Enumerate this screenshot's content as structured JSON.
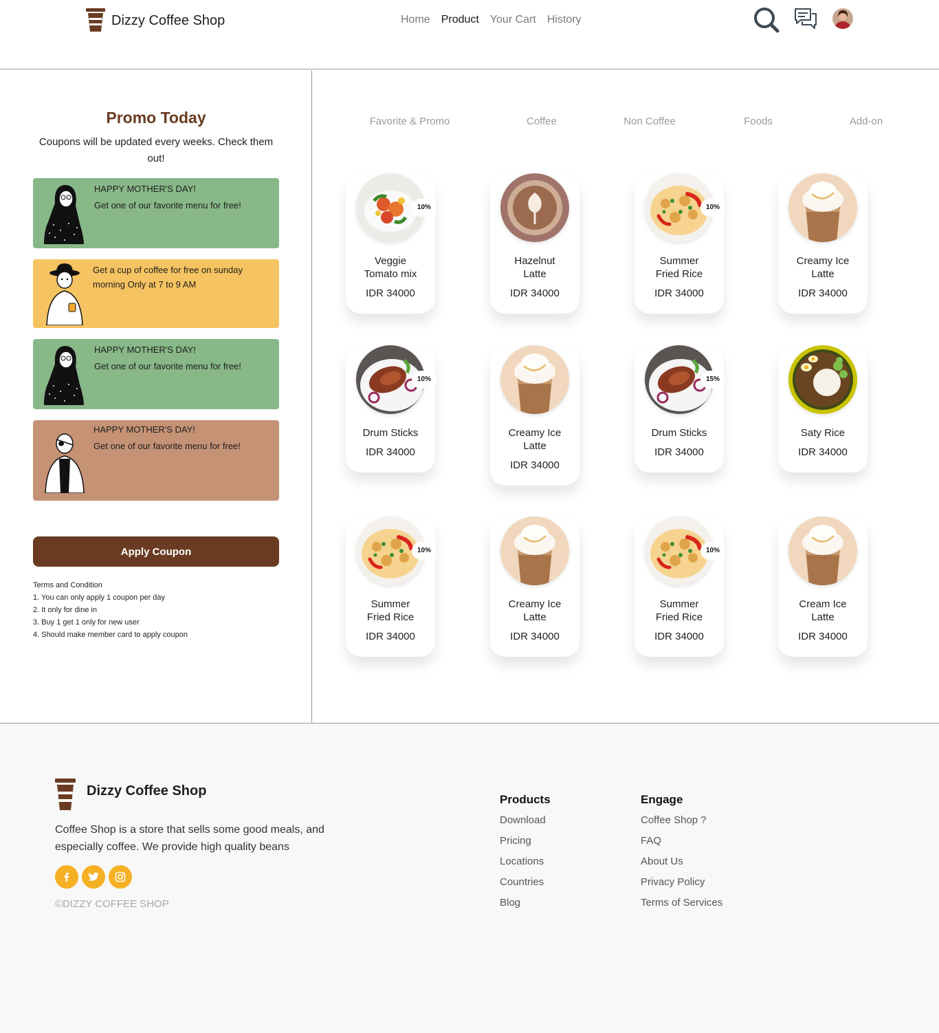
{
  "header": {
    "brand": "Dizzy Coffee Shop",
    "nav": [
      {
        "label": "Home",
        "active": false
      },
      {
        "label": "Product",
        "active": true
      },
      {
        "label": "Your Cart",
        "active": false
      },
      {
        "label": "History",
        "active": false
      }
    ]
  },
  "promo": {
    "title": "Promo Today",
    "subtitle": "Coupons will be updated every weeks. Check them out!",
    "coupons": [
      {
        "title": "HAPPY MOTHER'S DAY!",
        "desc": "Get one of our favorite menu for free!",
        "color": "#88b788"
      },
      {
        "title": "",
        "desc": "Get a cup of coffee for free on sunday morning Only at 7 to 9 AM",
        "color": "#f5c361"
      },
      {
        "title": "HAPPY MOTHER'S DAY!",
        "desc": "Get one of our favorite menu for free!",
        "color": "#88b788"
      },
      {
        "title": "HAPPY MOTHER'S DAY!",
        "desc": "Get one of our favorite menu for free!",
        "color": "#c59276"
      }
    ],
    "apply_label": "Apply Coupon",
    "terms_title": "Terms and Condition",
    "terms": [
      "1. You can only apply 1 coupon per day",
      "2. It only for dine in",
      "3. Buy 1 get 1 only for new user",
      "4. Should make member card to apply coupon"
    ]
  },
  "tabs": [
    "Favorite & Promo",
    "Coffee",
    "Non Coffee",
    "Foods",
    "Add-on"
  ],
  "products": [
    {
      "name": "Veggie Tomato mix",
      "price": "IDR 34000",
      "discount": "10%",
      "image": "veggie"
    },
    {
      "name": "Hazelnut Latte",
      "price": "IDR 34000",
      "discount": "",
      "image": "latte"
    },
    {
      "name": "Summer Fried Rice",
      "price": "IDR 34000",
      "discount": "10%",
      "image": "friedrice"
    },
    {
      "name": "Creamy Ice Latte",
      "price": "IDR 34000",
      "discount": "",
      "image": "icelatte"
    },
    {
      "name": "Drum Sticks",
      "price": "IDR 34000",
      "discount": "10%",
      "image": "drumstick"
    },
    {
      "name": "Creamy Ice Latte",
      "price": "IDR 34000",
      "discount": "",
      "image": "icelatte"
    },
    {
      "name": "Drum Sticks",
      "price": "IDR 34000",
      "discount": "15%",
      "image": "drumstick"
    },
    {
      "name": "Saty Rice",
      "price": "IDR 34000",
      "discount": "",
      "image": "satyrice"
    },
    {
      "name": "Summer Fried Rice",
      "price": "IDR 34000",
      "discount": "10%",
      "image": "friedrice"
    },
    {
      "name": "Creamy Ice Latte",
      "price": "IDR 34000",
      "discount": "",
      "image": "icelatte"
    },
    {
      "name": "Summer Fried Rice",
      "price": "IDR 34000",
      "discount": "10%",
      "image": "friedrice"
    },
    {
      "name": "Cream Ice Latte",
      "price": "IDR 34000",
      "discount": "",
      "image": "icelatte"
    }
  ],
  "footer": {
    "brand": "Dizzy Coffee Shop",
    "description": "Coffee Shop is a store that sells some good meals, and especially coffee. We provide high quality beans",
    "socials": [
      "facebook-icon",
      "twitter-icon",
      "instagram-icon"
    ],
    "copyright": "©DIZZY COFFEE SHOP",
    "columns": [
      {
        "title": "Products",
        "links": [
          "Download",
          "Pricing",
          "Locations",
          "Countries",
          "Blog"
        ]
      },
      {
        "title": "Engage",
        "links": [
          "Coffee Shop ?",
          "FAQ",
          "About Us",
          "Privacy Policy",
          "Terms of Services"
        ]
      }
    ]
  },
  "colors": {
    "brand_brown": "#6a3b22",
    "accent_yellow": "#f6b024"
  }
}
